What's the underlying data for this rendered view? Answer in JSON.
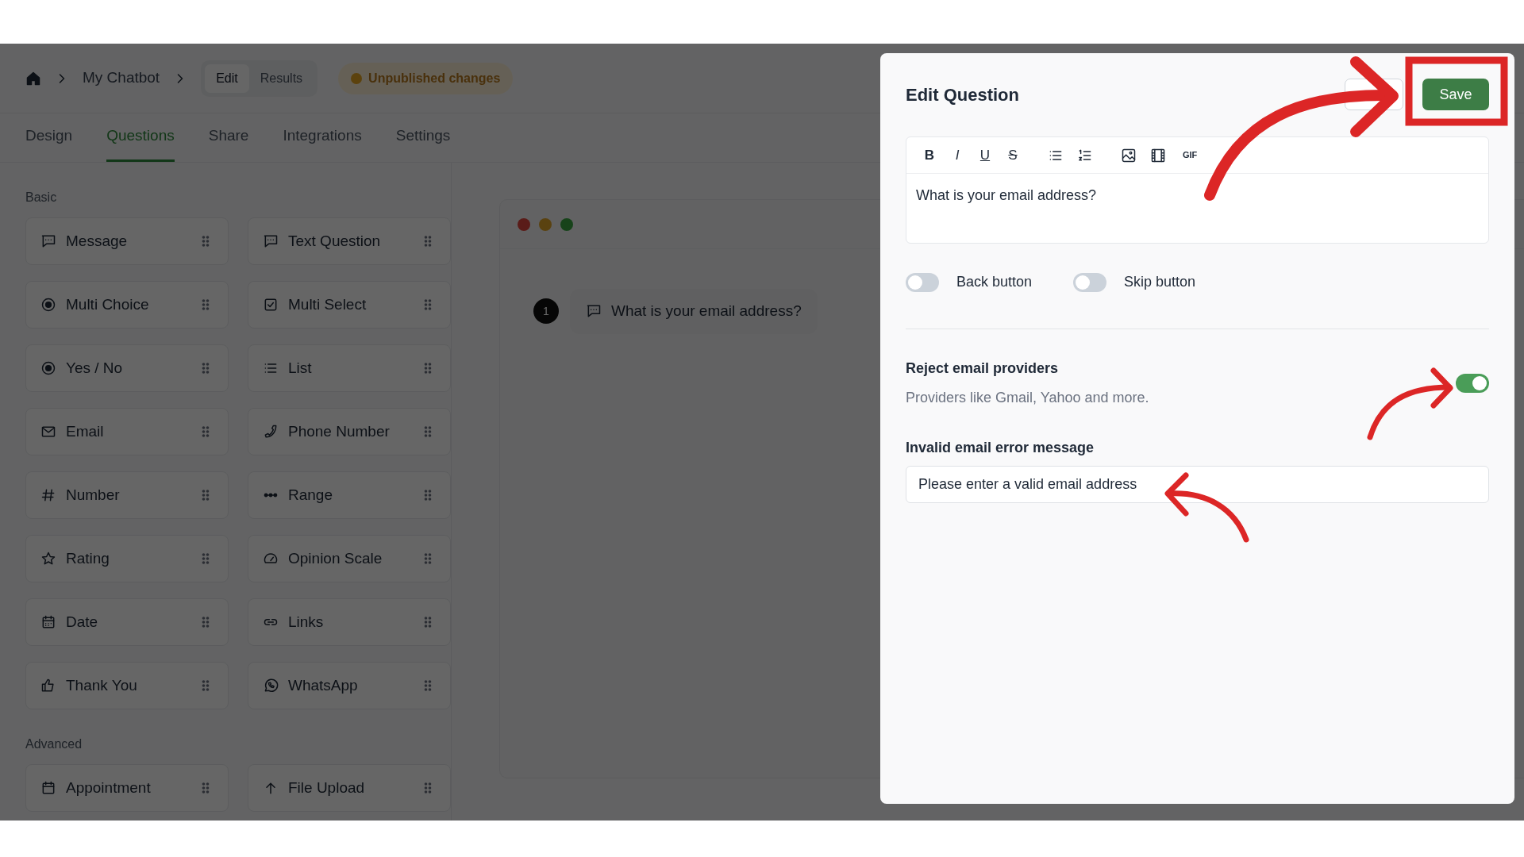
{
  "breadcrumb": {
    "title": "My Chatbot",
    "views": [
      {
        "label": "Edit",
        "selected": true
      },
      {
        "label": "Results",
        "selected": false
      }
    ],
    "status": "Unpublished changes"
  },
  "tabs": [
    {
      "label": "Design",
      "selected": false
    },
    {
      "label": "Questions",
      "selected": true
    },
    {
      "label": "Share",
      "selected": false
    },
    {
      "label": "Integrations",
      "selected": false
    },
    {
      "label": "Settings",
      "selected": false
    }
  ],
  "sidebar": {
    "sections": [
      {
        "title": "Basic",
        "items": [
          "Message",
          "Text Question",
          "Multi Choice",
          "Multi Select",
          "Yes / No",
          "List",
          "Email",
          "Phone Number",
          "Number",
          "Range",
          "Rating",
          "Opinion Scale",
          "Date",
          "Links",
          "Thank You",
          "WhatsApp"
        ]
      },
      {
        "title": "Advanced",
        "items": [
          "Appointment",
          "File Upload"
        ]
      }
    ]
  },
  "preview": {
    "questions": [
      {
        "number": "1",
        "text": "What is your email address?"
      }
    ]
  },
  "dialog": {
    "title": "Edit Question",
    "save_label": "Save",
    "editor": {
      "format_buttons": [
        "B",
        "I",
        "U",
        "S"
      ],
      "gif_button": "GIF",
      "text": "What is your email address?"
    },
    "toggles": [
      {
        "label": "Back button",
        "on": false
      },
      {
        "label": "Skip button",
        "on": false
      }
    ],
    "reject": {
      "label": "Reject email providers",
      "hint": "Providers like Gmail, Yahoo and more.",
      "on": true
    },
    "error_field": {
      "label": "Invalid email error message",
      "value": "Please enter a valid email address"
    }
  }
}
